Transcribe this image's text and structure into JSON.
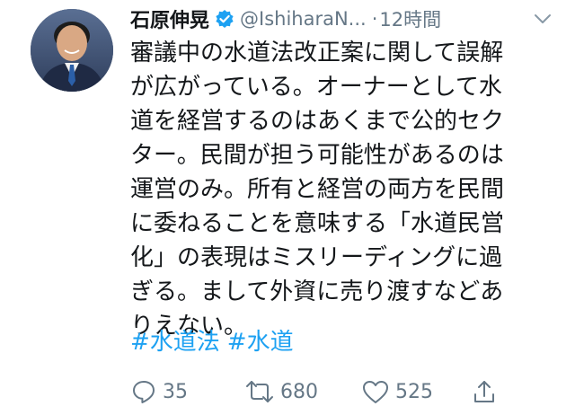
{
  "author": {
    "name": "石原伸晃",
    "handle": "@IshiharaN...",
    "separator": "·",
    "time": "12時間"
  },
  "tweet": {
    "lines": [
      "審議中の水道法改正案に関して誤解",
      "が広がっている。オーナーとして水",
      "道を経営するのはあくまで公的セク",
      "ター。民間が担う可能性があるのは",
      "運営のみ。所有と経営の両方を民間",
      "に委ねることを意味する「水道民営",
      "化」の表現はミスリーディングに過",
      "ぎる。まして外資に売り渡すなどあ",
      "りえない。"
    ],
    "hashtags": [
      "#水道法",
      "#水道"
    ]
  },
  "actions": {
    "reply_count": "35",
    "retweet_count": "680",
    "like_count": "525"
  },
  "icons": {
    "verified": "verified-badge-icon",
    "menu": "chevron-down-icon",
    "reply": "reply-icon",
    "retweet": "retweet-icon",
    "like": "heart-icon",
    "share": "share-icon"
  },
  "colors": {
    "text": "#14171a",
    "secondary": "#657786",
    "link": "#1da1f2",
    "verified": "#1da1f2"
  }
}
